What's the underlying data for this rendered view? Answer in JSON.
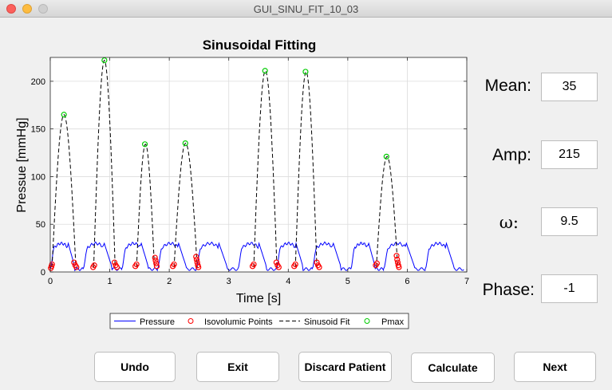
{
  "window": {
    "title": "GUI_SINU_FIT_10_03"
  },
  "plot": {
    "title": "Sinusoidal Fitting",
    "xlabel": "Time [s]",
    "ylabel": "Pressue [mmHg]",
    "xticks": [
      "0",
      "1",
      "2",
      "3",
      "4",
      "5",
      "6",
      "7"
    ],
    "yticks": [
      "0",
      "50",
      "100",
      "150",
      "200"
    ],
    "legend": {
      "pressure": "Pressure",
      "isovolumic": "Isovolumic Points",
      "fit": "Sinusoid Fit",
      "pmax": "Pmax"
    },
    "colors": {
      "pressure": "#0000ff",
      "isovolumic": "#ff0000",
      "fit": "#000000",
      "pmax": "#00cc00"
    }
  },
  "chart_data": {
    "type": "line",
    "title": "Sinusoidal Fitting",
    "xlabel": "Time [s]",
    "ylabel": "Pressue [mmHg]",
    "xlim": [
      0,
      7
    ],
    "ylim": [
      0,
      225
    ],
    "grid": true,
    "legend_position": "bottom-outside",
    "pressure_beats": [
      {
        "t0": 0.0,
        "t1": 0.55
      },
      {
        "t0": 0.55,
        "t1": 1.2
      },
      {
        "t0": 1.2,
        "t1": 1.8
      },
      {
        "t0": 1.8,
        "t1": 2.45
      },
      {
        "t0": 2.45,
        "t1": 3.15
      },
      {
        "t0": 3.15,
        "t1": 3.8
      },
      {
        "t0": 3.8,
        "t1": 4.4
      },
      {
        "t0": 4.4,
        "t1": 5.05
      },
      {
        "t0": 5.05,
        "t1": 5.6
      },
      {
        "t0": 5.6,
        "t1": 6.3
      },
      {
        "t0": 6.3,
        "t1": 6.95
      }
    ],
    "pressure_peak": 30,
    "pressure_base": 3,
    "sinusoid_fits": [
      {
        "t_start": 0.03,
        "t_peak": 0.23,
        "t_end": 0.43,
        "pmax": 165
      },
      {
        "t_start": 0.73,
        "t_peak": 0.91,
        "t_end": 1.09,
        "pmax": 222
      },
      {
        "t_start": 1.45,
        "t_peak": 1.59,
        "t_end": 1.75,
        "pmax": 134
      },
      {
        "t_start": 2.08,
        "t_peak": 2.27,
        "t_end": 2.47,
        "pmax": 135
      },
      {
        "t_start": 3.42,
        "t_peak": 3.61,
        "t_end": 3.81,
        "pmax": 211
      },
      {
        "t_start": 4.12,
        "t_peak": 4.29,
        "t_end": 4.48,
        "pmax": 210
      },
      {
        "t_start": 5.48,
        "t_peak": 5.65,
        "t_end": 5.84,
        "pmax": 121
      }
    ],
    "isovolumic_points": [
      [
        0.01,
        4
      ],
      [
        0.02,
        6
      ],
      [
        0.03,
        8
      ],
      [
        0.4,
        10
      ],
      [
        0.42,
        7
      ],
      [
        0.44,
        5
      ],
      [
        0.72,
        5
      ],
      [
        0.74,
        7
      ],
      [
        1.08,
        10
      ],
      [
        1.1,
        7
      ],
      [
        1.12,
        5
      ],
      [
        1.43,
        6
      ],
      [
        1.45,
        8
      ],
      [
        1.76,
        15
      ],
      [
        1.77,
        12
      ],
      [
        1.78,
        9
      ],
      [
        1.79,
        6
      ],
      [
        2.06,
        6
      ],
      [
        2.08,
        8
      ],
      [
        2.45,
        16
      ],
      [
        2.46,
        13
      ],
      [
        2.47,
        10
      ],
      [
        2.48,
        7
      ],
      [
        2.49,
        5
      ],
      [
        3.4,
        6
      ],
      [
        3.42,
        8
      ],
      [
        3.8,
        10
      ],
      [
        3.82,
        7
      ],
      [
        3.84,
        5
      ],
      [
        4.1,
        6
      ],
      [
        4.12,
        8
      ],
      [
        4.48,
        10
      ],
      [
        4.5,
        7
      ],
      [
        4.52,
        5
      ],
      [
        5.47,
        7
      ],
      [
        5.49,
        9
      ],
      [
        5.82,
        17
      ],
      [
        5.83,
        13
      ],
      [
        5.84,
        10
      ],
      [
        5.85,
        7
      ],
      [
        5.86,
        5
      ]
    ]
  },
  "params": {
    "mean": {
      "label": "Mean:",
      "value": "35"
    },
    "amp": {
      "label": "Amp:",
      "value": "215"
    },
    "omega": {
      "label": "ω:",
      "value": "9.5"
    },
    "phase": {
      "label": "Phase:",
      "value": "-1"
    }
  },
  "buttons": {
    "undo": "Undo",
    "exit": "Exit",
    "discard": "Discard Patient",
    "calculate": "Calculate",
    "next": "Next"
  }
}
